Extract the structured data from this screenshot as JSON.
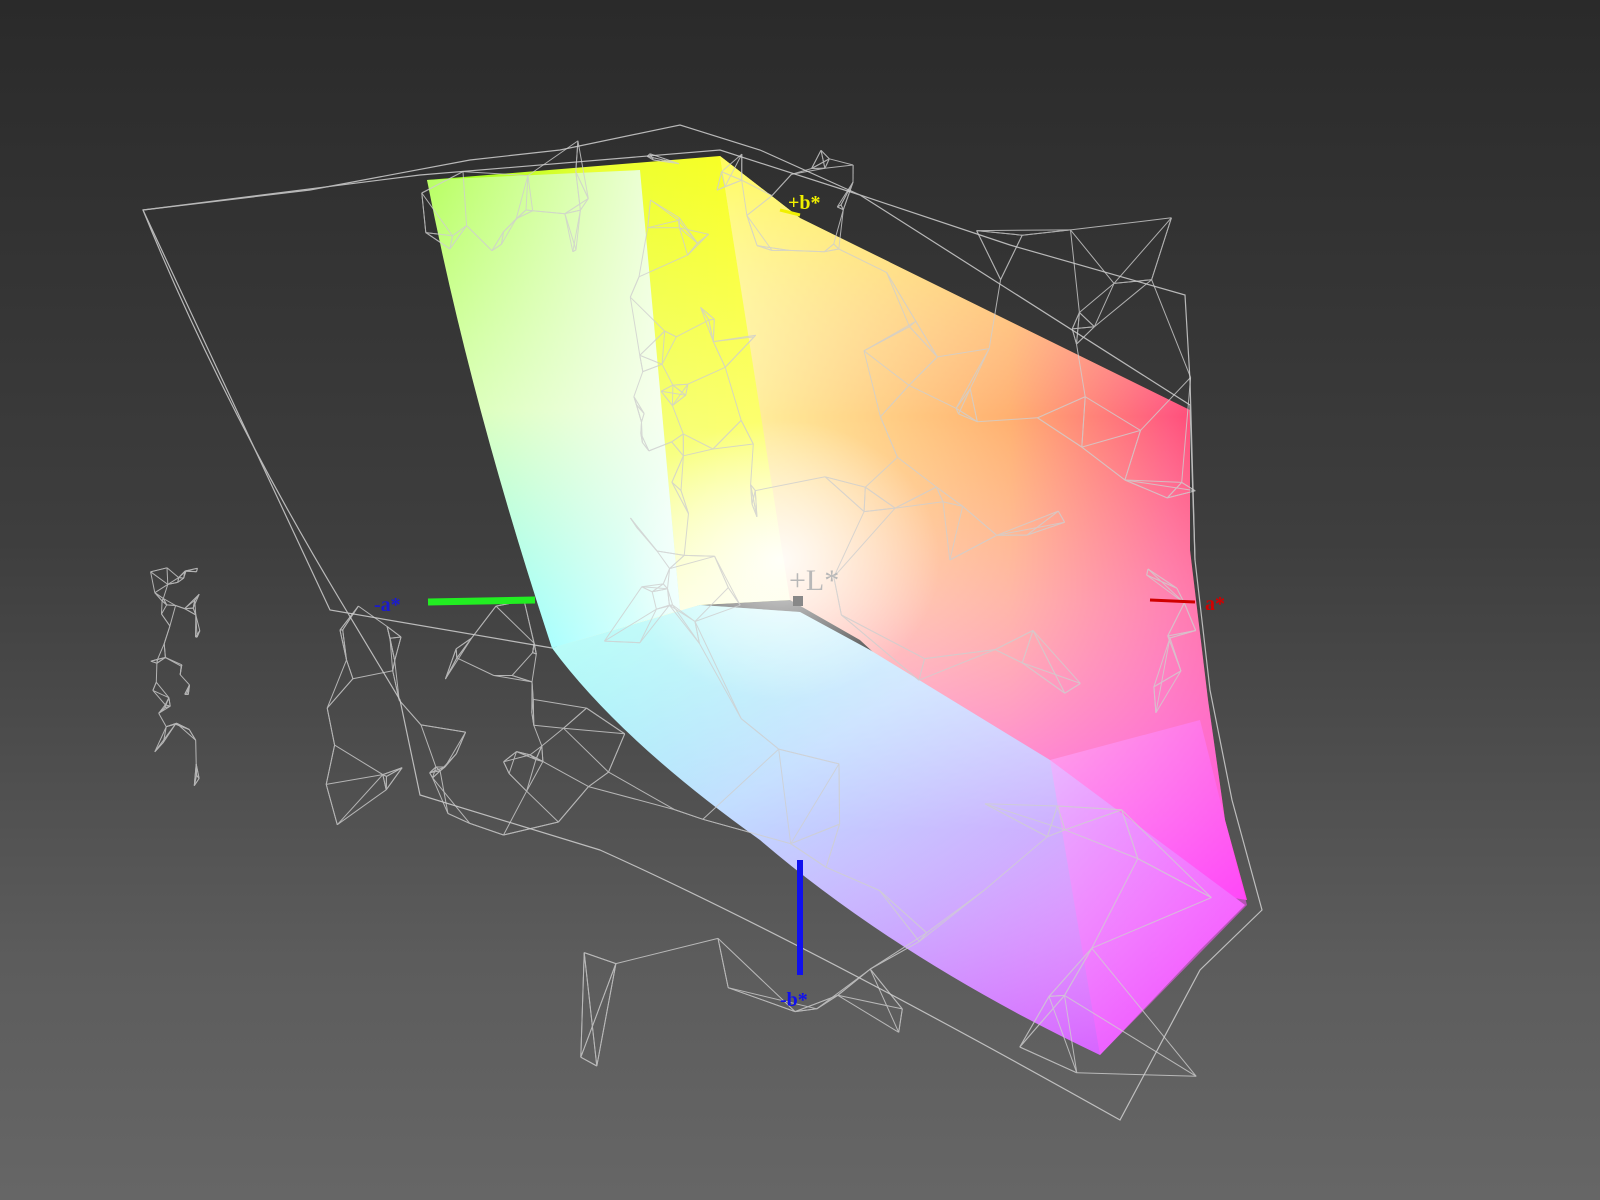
{
  "axis_labels": {
    "plus_L": "+L*",
    "plus_a": "a*",
    "minus_a": "-a*",
    "plus_b": "+b*",
    "minus_b": "-b*"
  },
  "colors": {
    "background_top": "#2a2a2a",
    "background_bottom": "#666666",
    "wireframe": "#d0d0d0",
    "axis_plus_L": "#b8b8b8",
    "axis_plus_a": "#d00000",
    "axis_minus_a": "#22ee22",
    "axis_plus_b": "#f0f000",
    "axis_minus_b": "#1010ee",
    "minus_a_label": "#1a1ad0"
  }
}
